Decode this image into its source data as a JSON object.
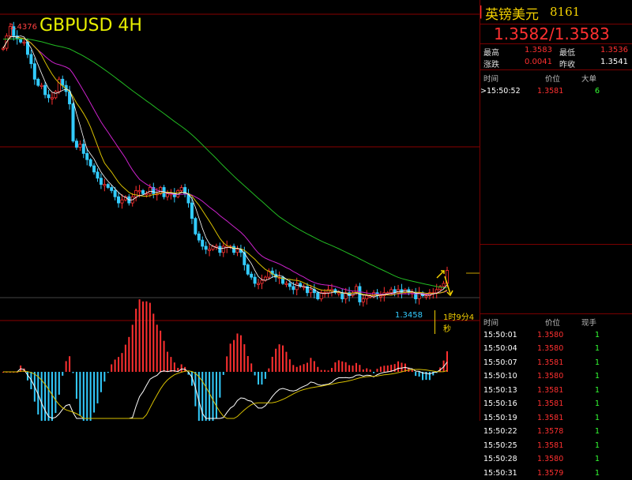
{
  "chart": {
    "title": "GBPUSD 4H",
    "high_label": "1.4376",
    "low_label": "1.3458",
    "countdown": "1时9分4秒"
  },
  "chart_data": {
    "type": "candlestick",
    "symbol": "GBPUSD",
    "timeframe": "4H",
    "ylim": [
      1.342,
      1.441
    ],
    "marked_high": 1.4376,
    "marked_low": 1.3458,
    "close": [
      1.43,
      1.434,
      1.437,
      1.434,
      1.433,
      1.432,
      1.432,
      1.428,
      1.425,
      1.42,
      1.418,
      1.418,
      1.415,
      1.414,
      1.414,
      1.416,
      1.42,
      1.418,
      1.416,
      1.412,
      1.4,
      1.398,
      1.399,
      1.396,
      1.394,
      1.392,
      1.39,
      1.388,
      1.386,
      1.386,
      1.385,
      1.384,
      1.382,
      1.38,
      1.381,
      1.382,
      1.38,
      1.382,
      1.384,
      1.384,
      1.383,
      1.383,
      1.385,
      1.383,
      1.383,
      1.385,
      1.382,
      1.383,
      1.383,
      1.382,
      1.384,
      1.385,
      1.383,
      1.38,
      1.375,
      1.37,
      1.368,
      1.366,
      1.365,
      1.365,
      1.366,
      1.366,
      1.364,
      1.366,
      1.366,
      1.366,
      1.364,
      1.365,
      1.364,
      1.36,
      1.357,
      1.356,
      1.354,
      1.354,
      1.355,
      1.356,
      1.358,
      1.357,
      1.356,
      1.356,
      1.354,
      1.354,
      1.353,
      1.352,
      1.354,
      1.353,
      1.353,
      1.351,
      1.352,
      1.351,
      1.349,
      1.351,
      1.351,
      1.352,
      1.352,
      1.351,
      1.351,
      1.349,
      1.351,
      1.35,
      1.351,
      1.353,
      1.348,
      1.349,
      1.35,
      1.35,
      1.351,
      1.35,
      1.35,
      1.351,
      1.351,
      1.352,
      1.351,
      1.352,
      1.351,
      1.352,
      1.351,
      1.351,
      1.349,
      1.351,
      1.35,
      1.35,
      1.351,
      1.351,
      1.352,
      1.353,
      1.354,
      1.3582
    ],
    "indicators": [
      "MA-fast",
      "MA-mid",
      "MA-slow",
      "MACD"
    ]
  },
  "panel": {
    "name": "英镑美元",
    "code": "8161",
    "bid_ask": "1.3582/1.3583",
    "stats": {
      "high_label": "最高",
      "high": "1.3583",
      "low_label": "最低",
      "low": "1.3536",
      "chg_label": "涨跌",
      "chg": "0.0041",
      "prev_label": "昨收",
      "prev": "1.3541"
    },
    "big_header": {
      "time": "时间",
      "price": "价位",
      "vol": "大单"
    },
    "big_rows": [
      {
        "time": ">15:50:52",
        "price": "1.3581",
        "vol": "6"
      }
    ],
    "tick_header": {
      "time": "时间",
      "price": "价位",
      "vol": "现手"
    },
    "ticks": [
      {
        "time": "15:50:01",
        "price": "1.3580",
        "vol": "1"
      },
      {
        "time": "15:50:04",
        "price": "1.3580",
        "vol": "1"
      },
      {
        "time": "15:50:07",
        "price": "1.3581",
        "vol": "1"
      },
      {
        "time": "15:50:10",
        "price": "1.3580",
        "vol": "1"
      },
      {
        "time": "15:50:13",
        "price": "1.3581",
        "vol": "1"
      },
      {
        "time": "15:50:16",
        "price": "1.3581",
        "vol": "1"
      },
      {
        "time": "15:50:19",
        "price": "1.3581",
        "vol": "1"
      },
      {
        "time": "15:50:22",
        "price": "1.3578",
        "vol": "1"
      },
      {
        "time": "15:50:25",
        "price": "1.3581",
        "vol": "1"
      },
      {
        "time": "15:50:28",
        "price": "1.3580",
        "vol": "1"
      },
      {
        "time": "15:50:31",
        "price": "1.3579",
        "vol": "1"
      }
    ],
    "colors": {
      "accent": "#ff3030",
      "name": "#f3d000",
      "vol": "#33ff33"
    }
  }
}
